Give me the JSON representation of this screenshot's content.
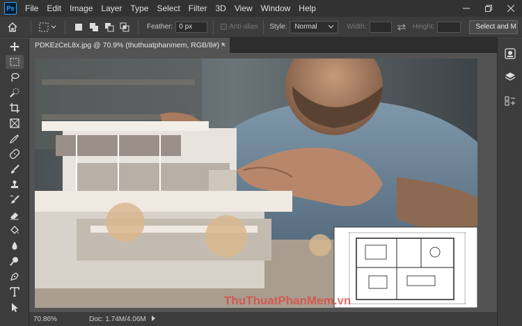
{
  "app": {
    "logo": "Ps"
  },
  "menu": [
    "File",
    "Edit",
    "Image",
    "Layer",
    "Type",
    "Select",
    "Filter",
    "3D",
    "View",
    "Window",
    "Help"
  ],
  "options": {
    "feather_label": "Feather:",
    "feather_value": "0 px",
    "antialias_label": "Anti-alias",
    "style_label": "Style:",
    "style_value": "Normal",
    "width_label": "Width:",
    "height_label": "Height:",
    "select_mask_label": "Select and M"
  },
  "document": {
    "tab_title": "PDKEzCeL8x.jpg @ 70.9% (thuthuatphanmem, RGB/8#) *",
    "close_glyph": "×"
  },
  "status": {
    "zoom": "70.86%",
    "doc_info": "Doc: 1.74M/4.06M"
  },
  "watermark": {
    "text": "ThuThuatPhanMem.vn"
  },
  "colors": {
    "menubar": "#323232",
    "panel": "#3c3c3c",
    "canvas_bg": "#535353",
    "accent": "#31a8ff"
  }
}
